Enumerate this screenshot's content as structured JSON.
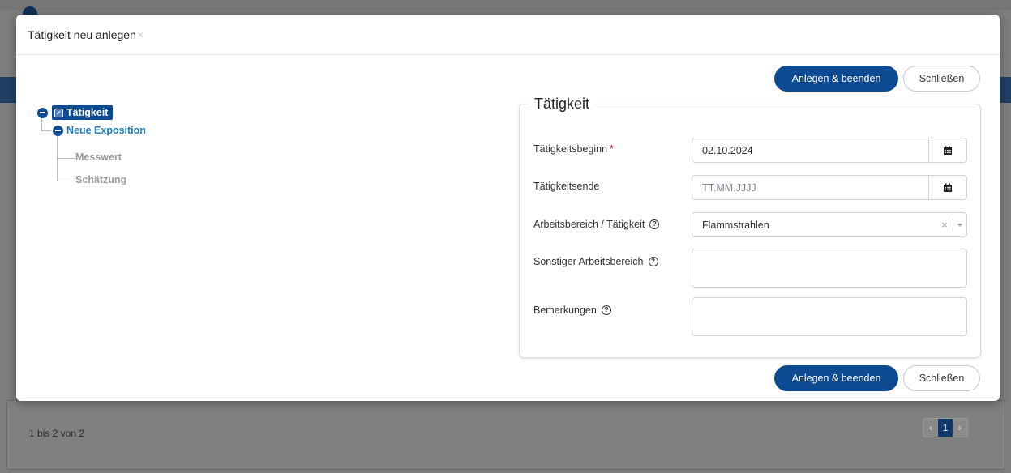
{
  "background": {
    "pagination_info": "1 bis 2 von 2",
    "pager": {
      "prev": "‹",
      "current": "1",
      "next": "›"
    }
  },
  "modal": {
    "title": "Tätigkeit neu anlegen",
    "close_icon": "×",
    "buttons": {
      "create_and_close": "Anlegen & beenden",
      "close": "Schließen"
    },
    "tree": {
      "root": {
        "label": "Tätigkeit",
        "checked": true
      },
      "child": {
        "label": "Neue Exposition"
      },
      "leaves": [
        "Messwert",
        "Schätzung"
      ]
    },
    "form": {
      "legend": "Tätigkeit",
      "fields": {
        "start": {
          "label": "Tätigkeitsbeginn",
          "required_marker": "*",
          "value": "02.10.2024",
          "icon": "calendar-icon"
        },
        "end": {
          "label": "Tätigkeitsende",
          "placeholder": "TT.MM.JJJJ",
          "icon": "calendar-icon"
        },
        "area": {
          "label": "Arbeitsbereich / Tätigkeit",
          "value": "Flammstrahlen",
          "clear": "×"
        },
        "other_area": {
          "label": "Sonstiger Arbeitsbereich",
          "value": ""
        },
        "remarks": {
          "label": "Bemerkungen",
          "value": ""
        }
      },
      "help_icon_glyph": "?"
    }
  },
  "colors": {
    "primary": "#0d4a92",
    "link": "#1d7ec3",
    "required": "#d0021b",
    "overlay": "#7d7d7d"
  }
}
